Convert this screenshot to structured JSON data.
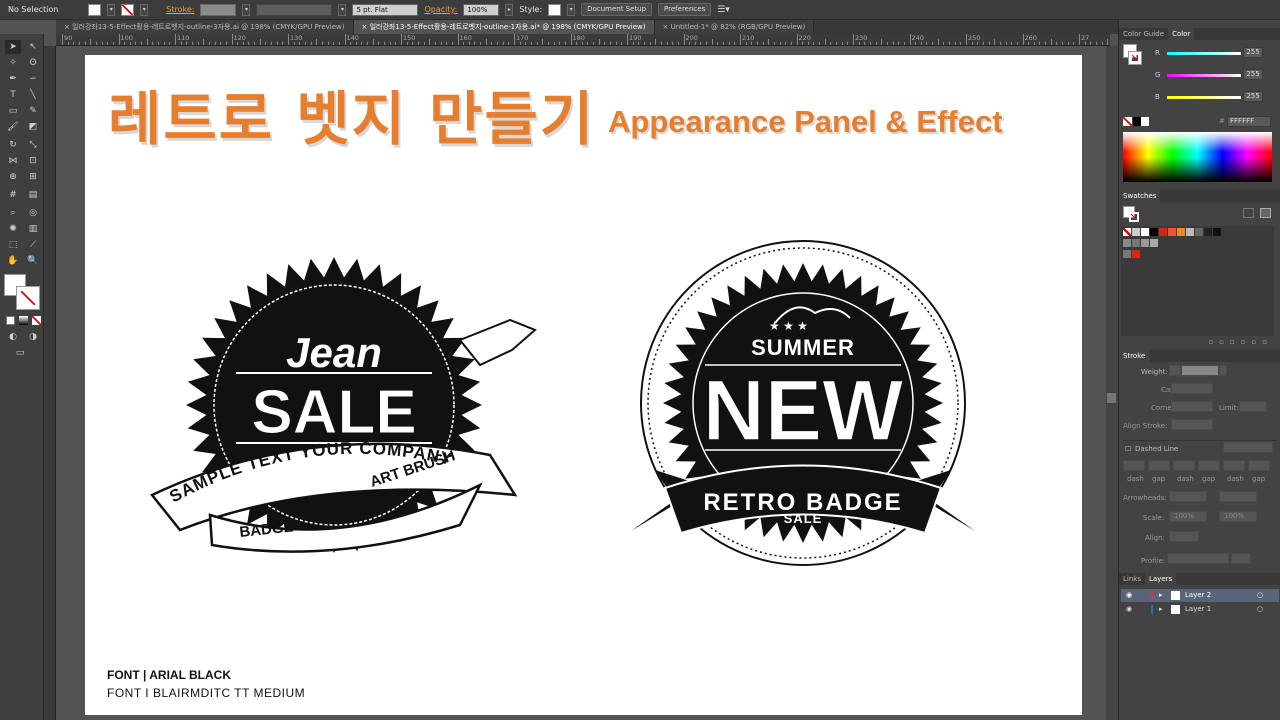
{
  "control_bar": {
    "selection": "No Selection",
    "stroke_label": "Stroke:",
    "brush": "5 pt. Flat",
    "opacity_label": "Opacity:",
    "opacity_value": "100%",
    "style_label": "Style:",
    "document_setup": "Document Setup",
    "preferences": "Preferences"
  },
  "tabs": [
    "일러강좌13-5-Effect활용-레트로벳지-outline-3자용.ai @ 198% (CMYK/GPU Preview)",
    "일러강좌13-5-Effect활용-레트로벳지-outline-1자용.ai* @ 198% (CMYK/GPU Preview)",
    "Untitled-1* @ 82% (RGB/GPU Preview)"
  ],
  "ruler_marks": [
    "90",
    "100",
    "110",
    "120",
    "130",
    "140",
    "150",
    "160",
    "170",
    "180",
    "190",
    "200",
    "210",
    "220",
    "230",
    "240",
    "250",
    "260",
    "27"
  ],
  "artboard": {
    "title_korean": "레트로 벳지 만들기",
    "title_english": "Appearance Panel & Effect",
    "font_line1": "FONT | ARIAL BLACK",
    "font_line2": "FONT I BLAIRMDITC TT MEDIUM"
  },
  "badge_left": {
    "script": "Jean",
    "main": "SALE",
    "ribbon_text_1": "SAMPLE TEXT YOUR COMPANY",
    "ribbon_text_2": "ART BRUSH",
    "ribbon_text_3": "BADGE"
  },
  "badge_right": {
    "top": "SUMMER",
    "main": "NEW",
    "ribbon_text": "RETRO BADGE",
    "bottom": "SALE"
  },
  "color_panel": {
    "tab1": "Color Guide",
    "tab2": "Color",
    "r_label": "R",
    "g_label": "G",
    "b_label": "B",
    "r_value": "255",
    "g_value": "255",
    "b_value": "255",
    "hex_symbol": "#",
    "hex_value": "FFFFFF"
  },
  "swatches_panel": {
    "title": "Swatches"
  },
  "stroke_panel": {
    "title": "Stroke",
    "weight_label": "Weight:",
    "cap_label": "Cap:",
    "corner_label": "Corner:",
    "limit_label": "Limit:",
    "align_label": "Align Stroke:",
    "dashed_label": "Dashed Line",
    "dash_labels": [
      "dash",
      "gap",
      "dash",
      "gap",
      "dash",
      "gap"
    ],
    "arrowheads_label": "Arrowheads:",
    "scale_label": "Scale:",
    "scale_v1": "100%",
    "scale_v2": "100%",
    "align_label2": "Align:",
    "profile_label": "Profile:"
  },
  "layers_panel": {
    "tab1": "Links",
    "tab2": "Layers",
    "layers": [
      "Layer 2",
      "Layer 1"
    ]
  },
  "colors": {
    "title_orange": "#e57e2e",
    "panel_bg": "#434343",
    "canvas_bg": "#535353",
    "stroke_active": "#f0a030"
  }
}
